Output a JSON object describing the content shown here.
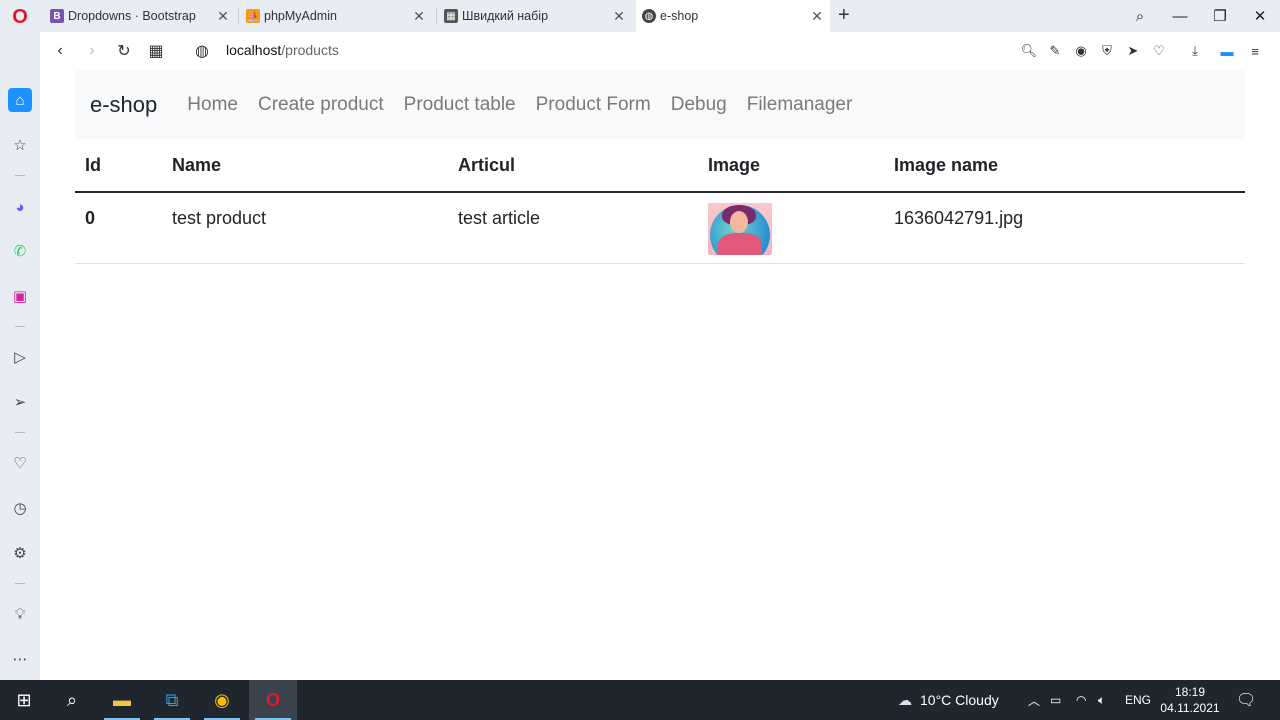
{
  "tabs": [
    {
      "title": "Dropdowns · Bootstrap",
      "favicon": "bootstrap-icon"
    },
    {
      "title": "phpMyAdmin",
      "favicon": "phpmyadmin-icon"
    },
    {
      "title": "Швидкий набір",
      "favicon": "speed-dial-icon"
    },
    {
      "title": "e-shop",
      "favicon": "globe-icon"
    }
  ],
  "address": {
    "host": "localhost",
    "path": "/products"
  },
  "navbar": {
    "brand": "e-shop",
    "links": [
      "Home",
      "Create product",
      "Product table",
      "Product Form",
      "Debug",
      "Filemanager"
    ]
  },
  "table": {
    "headers": [
      "Id",
      "Name",
      "Articul",
      "Image",
      "Image name"
    ],
    "rows": [
      {
        "id": "0",
        "name": "test product",
        "articul": "test article",
        "image": "product-thumbnail",
        "image_name": "1636042791.jpg"
      }
    ]
  },
  "taskbar": {
    "weather": "10°C  Cloudy",
    "lang": "ENG",
    "time": "18:19",
    "date": "04.11.2021"
  },
  "colors": {
    "accent": "#0d6efd",
    "opera_red": "#e0182d",
    "navbar_bg": "#f8f9fa",
    "taskbar_bg": "#20262e"
  }
}
